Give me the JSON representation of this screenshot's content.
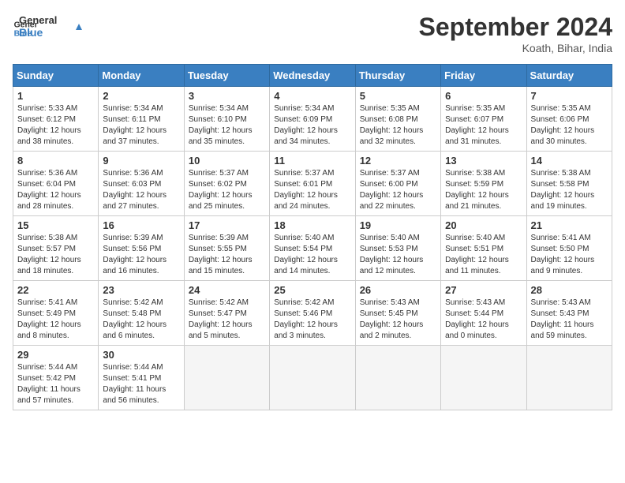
{
  "header": {
    "logo_line1": "General",
    "logo_line2": "Blue",
    "month": "September 2024",
    "location": "Koath, Bihar, India"
  },
  "weekdays": [
    "Sunday",
    "Monday",
    "Tuesday",
    "Wednesday",
    "Thursday",
    "Friday",
    "Saturday"
  ],
  "weeks": [
    [
      {
        "day": 1,
        "sunrise": "5:33 AM",
        "sunset": "6:12 PM",
        "daylight": "12 hours and 38 minutes."
      },
      {
        "day": 2,
        "sunrise": "5:34 AM",
        "sunset": "6:11 PM",
        "daylight": "12 hours and 37 minutes."
      },
      {
        "day": 3,
        "sunrise": "5:34 AM",
        "sunset": "6:10 PM",
        "daylight": "12 hours and 35 minutes."
      },
      {
        "day": 4,
        "sunrise": "5:34 AM",
        "sunset": "6:09 PM",
        "daylight": "12 hours and 34 minutes."
      },
      {
        "day": 5,
        "sunrise": "5:35 AM",
        "sunset": "6:08 PM",
        "daylight": "12 hours and 32 minutes."
      },
      {
        "day": 6,
        "sunrise": "5:35 AM",
        "sunset": "6:07 PM",
        "daylight": "12 hours and 31 minutes."
      },
      {
        "day": 7,
        "sunrise": "5:35 AM",
        "sunset": "6:06 PM",
        "daylight": "12 hours and 30 minutes."
      }
    ],
    [
      {
        "day": 8,
        "sunrise": "5:36 AM",
        "sunset": "6:04 PM",
        "daylight": "12 hours and 28 minutes."
      },
      {
        "day": 9,
        "sunrise": "5:36 AM",
        "sunset": "6:03 PM",
        "daylight": "12 hours and 27 minutes."
      },
      {
        "day": 10,
        "sunrise": "5:37 AM",
        "sunset": "6:02 PM",
        "daylight": "12 hours and 25 minutes."
      },
      {
        "day": 11,
        "sunrise": "5:37 AM",
        "sunset": "6:01 PM",
        "daylight": "12 hours and 24 minutes."
      },
      {
        "day": 12,
        "sunrise": "5:37 AM",
        "sunset": "6:00 PM",
        "daylight": "12 hours and 22 minutes."
      },
      {
        "day": 13,
        "sunrise": "5:38 AM",
        "sunset": "5:59 PM",
        "daylight": "12 hours and 21 minutes."
      },
      {
        "day": 14,
        "sunrise": "5:38 AM",
        "sunset": "5:58 PM",
        "daylight": "12 hours and 19 minutes."
      }
    ],
    [
      {
        "day": 15,
        "sunrise": "5:38 AM",
        "sunset": "5:57 PM",
        "daylight": "12 hours and 18 minutes."
      },
      {
        "day": 16,
        "sunrise": "5:39 AM",
        "sunset": "5:56 PM",
        "daylight": "12 hours and 16 minutes."
      },
      {
        "day": 17,
        "sunrise": "5:39 AM",
        "sunset": "5:55 PM",
        "daylight": "12 hours and 15 minutes."
      },
      {
        "day": 18,
        "sunrise": "5:40 AM",
        "sunset": "5:54 PM",
        "daylight": "12 hours and 14 minutes."
      },
      {
        "day": 19,
        "sunrise": "5:40 AM",
        "sunset": "5:53 PM",
        "daylight": "12 hours and 12 minutes."
      },
      {
        "day": 20,
        "sunrise": "5:40 AM",
        "sunset": "5:51 PM",
        "daylight": "12 hours and 11 minutes."
      },
      {
        "day": 21,
        "sunrise": "5:41 AM",
        "sunset": "5:50 PM",
        "daylight": "12 hours and 9 minutes."
      }
    ],
    [
      {
        "day": 22,
        "sunrise": "5:41 AM",
        "sunset": "5:49 PM",
        "daylight": "12 hours and 8 minutes."
      },
      {
        "day": 23,
        "sunrise": "5:42 AM",
        "sunset": "5:48 PM",
        "daylight": "12 hours and 6 minutes."
      },
      {
        "day": 24,
        "sunrise": "5:42 AM",
        "sunset": "5:47 PM",
        "daylight": "12 hours and 5 minutes."
      },
      {
        "day": 25,
        "sunrise": "5:42 AM",
        "sunset": "5:46 PM",
        "daylight": "12 hours and 3 minutes."
      },
      {
        "day": 26,
        "sunrise": "5:43 AM",
        "sunset": "5:45 PM",
        "daylight": "12 hours and 2 minutes."
      },
      {
        "day": 27,
        "sunrise": "5:43 AM",
        "sunset": "5:44 PM",
        "daylight": "12 hours and 0 minutes."
      },
      {
        "day": 28,
        "sunrise": "5:43 AM",
        "sunset": "5:43 PM",
        "daylight": "11 hours and 59 minutes."
      }
    ],
    [
      {
        "day": 29,
        "sunrise": "5:44 AM",
        "sunset": "5:42 PM",
        "daylight": "11 hours and 57 minutes."
      },
      {
        "day": 30,
        "sunrise": "5:44 AM",
        "sunset": "5:41 PM",
        "daylight": "11 hours and 56 minutes."
      },
      null,
      null,
      null,
      null,
      null
    ]
  ]
}
